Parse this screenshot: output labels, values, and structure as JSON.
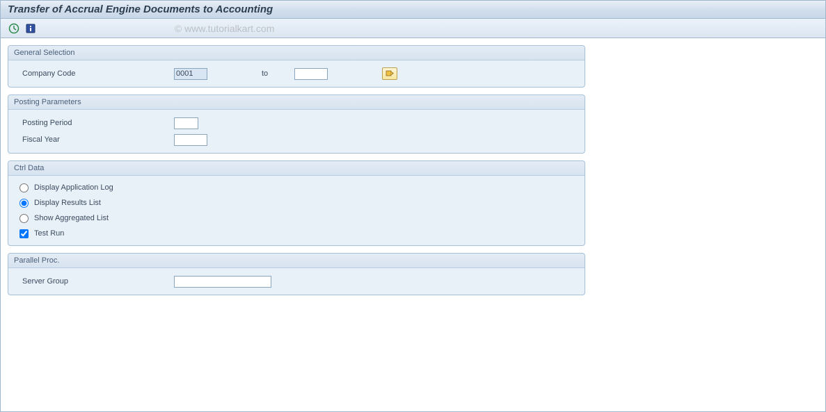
{
  "title": "Transfer of Accrual Engine Documents to Accounting",
  "watermark": "© www.tutorialkart.com",
  "groups": {
    "general": {
      "title": "General Selection",
      "company_code": {
        "label": "Company Code",
        "value": "0001",
        "to_label": "to",
        "to_value": ""
      }
    },
    "posting": {
      "title": "Posting Parameters",
      "posting_period": {
        "label": "Posting Period",
        "value": ""
      },
      "fiscal_year": {
        "label": "Fiscal Year",
        "value": ""
      }
    },
    "ctrl": {
      "title": "Ctrl Data",
      "display_app_log": {
        "label": "Display Application Log",
        "checked": false
      },
      "display_results": {
        "label": "Display Results List",
        "checked": true
      },
      "show_aggregated": {
        "label": "Show Aggregated List",
        "checked": false
      },
      "test_run": {
        "label": "Test Run",
        "checked": true
      }
    },
    "parallel": {
      "title": "Parallel Proc.",
      "server_group": {
        "label": "Server Group",
        "value": ""
      }
    }
  }
}
